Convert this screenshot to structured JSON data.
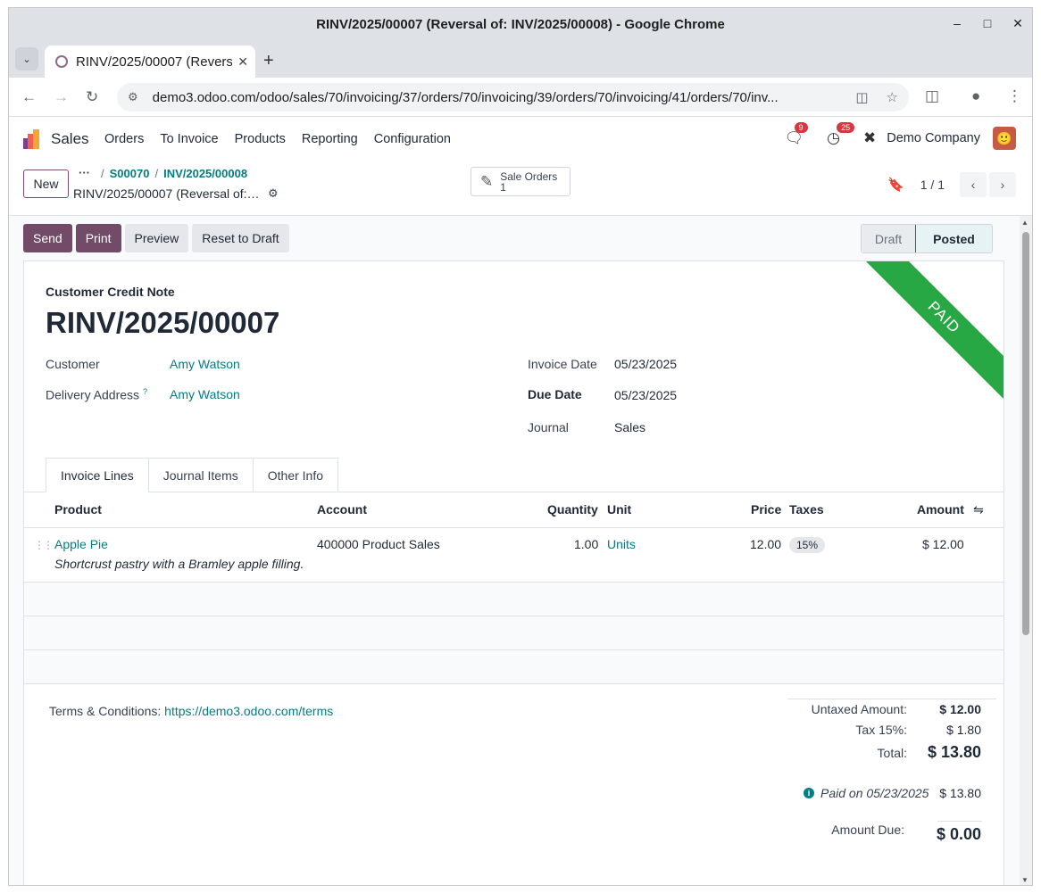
{
  "window": {
    "title": "RINV/2025/00007 (Reversal of: INV/2025/00008) - Google Chrome"
  },
  "browser": {
    "tab_title": "RINV/2025/00007 (Reversal of: INV/2025/00008)",
    "url": "demo3.odoo.com/odoo/sales/70/invoicing/37/orders/70/invoicing/39/orders/70/invoicing/41/orders/70/inv..."
  },
  "navbar": {
    "app_name": "Sales",
    "menu": [
      "Orders",
      "To Invoice",
      "Products",
      "Reporting",
      "Configuration"
    ],
    "messages_count": "9",
    "activities_count": "25",
    "company": "Demo Company"
  },
  "control_panel": {
    "new_label": "New",
    "breadcrumb_dots": "···",
    "breadcrumbs": [
      "S00070",
      "INV/2025/00008"
    ],
    "record_title": "RINV/2025/00007 (Reversal of:…",
    "smart_button": {
      "label": "Sale Orders",
      "count": "1"
    },
    "pager": "1 / 1"
  },
  "actions": {
    "send": "Send",
    "print": "Print",
    "preview": "Preview",
    "reset": "Reset to Draft"
  },
  "status": {
    "draft": "Draft",
    "posted": "Posted"
  },
  "document": {
    "ribbon": "PAID",
    "type": "Customer Credit Note",
    "name": "RINV/2025/00007",
    "customer_label": "Customer",
    "customer": "Amy Watson",
    "delivery_label": "Delivery Address",
    "delivery_hint": "?",
    "delivery": "Amy Watson",
    "invoice_date_label": "Invoice Date",
    "invoice_date": "05/23/2025",
    "due_date_label": "Due Date",
    "due_date": "05/23/2025",
    "journal_label": "Journal",
    "journal": "Sales"
  },
  "tabs": [
    "Invoice Lines",
    "Journal Items",
    "Other Info"
  ],
  "table": {
    "headers": [
      "Product",
      "Account",
      "Quantity",
      "Unit",
      "Price",
      "Taxes",
      "Amount"
    ],
    "rows": [
      {
        "product": "Apple Pie",
        "description": "Shortcrust pastry with a Bramley apple filling.",
        "account": "400000 Product Sales",
        "quantity": "1.00",
        "unit": "Units",
        "price": "12.00",
        "taxes": "15%",
        "amount": "$ 12.00"
      }
    ]
  },
  "footer": {
    "terms_label": "Terms & Conditions:",
    "terms_link": "https://demo3.odoo.com/terms",
    "untaxed_label": "Untaxed Amount:",
    "untaxed": "$ 12.00",
    "tax_label": "Tax 15%:",
    "tax": "$ 1.80",
    "total_label": "Total:",
    "total": "$ 13.80",
    "paid_on": "Paid on 05/23/2025",
    "paid_amount": "$ 13.80",
    "amount_due_label": "Amount Due:",
    "amount_due": "$ 0.00"
  },
  "colors": {
    "primary": "#714b67",
    "link": "#017e84",
    "ribbon": "#28a745"
  }
}
